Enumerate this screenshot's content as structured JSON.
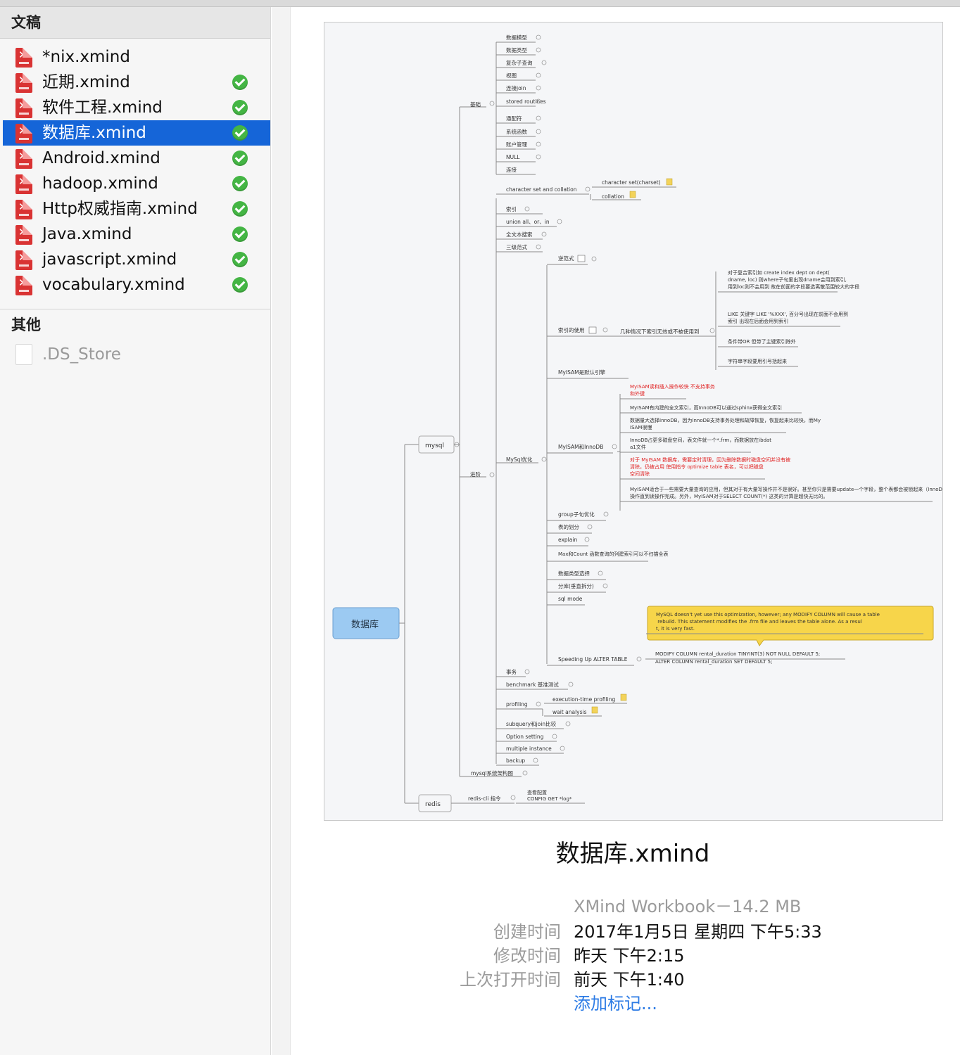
{
  "sidebar": {
    "section_documents": "文稿",
    "files": [
      {
        "name": "*nix.xmind",
        "synced": false,
        "selected": false
      },
      {
        "name": "近期.xmind",
        "synced": true,
        "selected": false
      },
      {
        "name": "软件工程.xmind",
        "synced": true,
        "selected": false
      },
      {
        "name": "数据库.xmind",
        "synced": true,
        "selected": true
      },
      {
        "name": "Android.xmind",
        "synced": true,
        "selected": false
      },
      {
        "name": "hadoop.xmind",
        "synced": true,
        "selected": false
      },
      {
        "name": "Http权威指南.xmind",
        "synced": true,
        "selected": false
      },
      {
        "name": "Java.xmind",
        "synced": true,
        "selected": false
      },
      {
        "name": "javascript.xmind",
        "synced": true,
        "selected": false
      },
      {
        "name": "vocabulary.xmind",
        "synced": true,
        "selected": false
      }
    ],
    "section_other": "其他",
    "other_files": [
      {
        "name": ".DS_Store"
      }
    ],
    "icon": "xmind-file-icon",
    "status_icon": "check-icon"
  },
  "mindmap": {
    "root": "数据库",
    "mysql": "mysql",
    "redis": "redis",
    "basic": "基础",
    "basic_items": [
      "数据模型",
      "数据类型",
      "复杂子查询",
      "视图",
      "连接join",
      "stored routines",
      "通配符",
      "系统函数",
      "账户管理",
      "NULL",
      "连接"
    ],
    "advanced": "进阶",
    "adv_items": [
      "character set and collation",
      "索引",
      "union all、or、in",
      "全文本搜索",
      "三级范式"
    ],
    "charset_children": [
      "character set(charset)",
      "collation"
    ],
    "mysql_opt": "MySql优化",
    "opt_items": [
      "逆范式",
      "索引的使用",
      "MyISAM是默认引擎",
      "MyISAM和InnoDB",
      "group子句优化",
      "表的划分",
      "explain",
      "Max和Count 函数查询的列建索引可以不扫描全表",
      "数据类型选择",
      "分库(垂直拆分)",
      "sql mode",
      "Speeding Up ALTER TABLE"
    ],
    "index_usage_child": "几种情况下索引无效或不被使用到",
    "index_usage_notes": [
      "对于复合索引如 create index dept on dept(dname, loc) 则where子句里出现dname会用到索引,用到loc则不会用到 故在前面的字段要选离散范围较大的字段",
      "LIKE 关键字 LIKE '%XXX', 百分号出现在前面不会用到索引 出现在后面会用到索引",
      "条件带OR 但带了主键索引除外",
      "字符串字段要用引号括起来"
    ],
    "myisam_innodb_notes": [
      "MyISAM读和插入操作较快 不支持事务和外键",
      "MyISAM有内建的全文索引，而InnoDB可以通过sphinx获得全文索引",
      "数据量大选择InnoDB，因为InnoDB支持事务处理和故障恢复，恢复起来比较快，而MyISAM很慢",
      "InnoDB占更多磁盘空间，表文件就一个*.frm，而数据放在ibdata1文件",
      "对于 MyISAM 数据库，需要定时清理，因为删除数据时磁盘空间并没有被清除，仍被占用 使用指令 optimize table 表名，可以把磁盘空间清除",
      "MyISAM适合于一些需要大量查询的应用，但其对于有大量写操作并不是很好。甚至你只是需要update一个字段，整个表都会被锁起来（InnoDB支持行锁），而别的进程，就算是读进程都无法操作直到读操作完成。另外，MyISAM对于SELECT COUNT(*) 这类的计算是超快无比的。"
    ],
    "callout": "MySQL doesn't yet use this optimization, however; any MODIFY COLUMN will cause a table rebuild. This statement modifies the .frm file and leaves the table alone. As a result, it is very fast.",
    "alter_code": [
      "MODIFY COLUMN rental_duration TINYINT(3) NOT NULL DEFAULT 5;",
      "ALTER COLUMN rental_duration SET DEFAULT 5;"
    ],
    "adv_tail": [
      "事务",
      "benchmark 基准测试",
      "profiling",
      "subquery和join比较",
      "Option setting",
      "multiple instance",
      "backup"
    ],
    "profiling_children": [
      "execution-time profiling",
      "wait analysis"
    ],
    "arch": "mysql系统架构图",
    "redis_cmd": "redis-cli 指令",
    "redis_cmd_notes": [
      "查看配置",
      "CONFIG GET *log*"
    ]
  },
  "details": {
    "title": "数据库.xmind",
    "kind": "XMind Workbook－14.2 MB",
    "created_label": "创建时间",
    "created_value": "2017年1月5日 星期四 下午5:33",
    "modified_label": "修改时间",
    "modified_value": "昨天 下午2:15",
    "opened_label": "上次打开时间",
    "opened_value": "前天 下午1:40",
    "add_tag": "添加标记..."
  }
}
